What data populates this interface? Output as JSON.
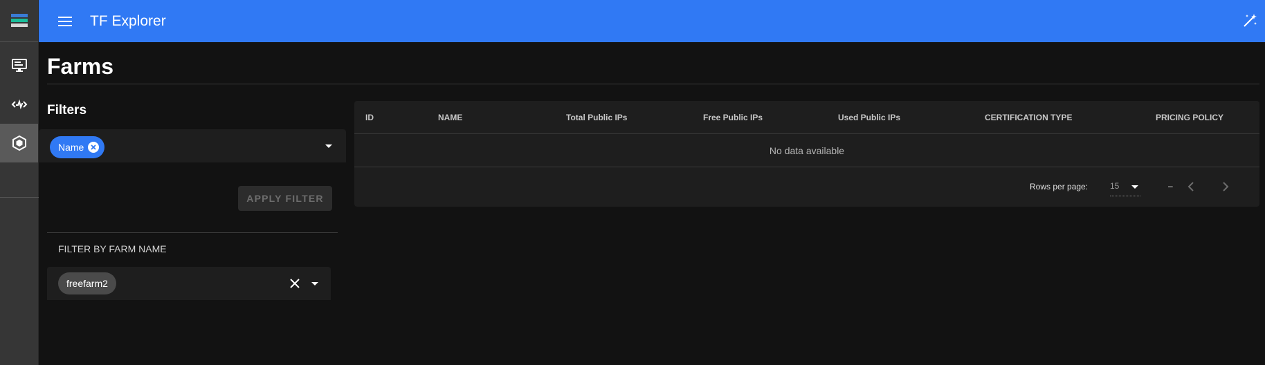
{
  "header": {
    "app_title": "TF Explorer",
    "accent_color": "#3079f4"
  },
  "rail": {
    "items": [
      {
        "icon": "logo-stack-icon"
      },
      {
        "icon": "monitor-icon"
      },
      {
        "icon": "code-pulse-icon"
      },
      {
        "icon": "cube-icon",
        "active": true
      }
    ]
  },
  "page": {
    "title": "Farms"
  },
  "filters": {
    "title": "Filters",
    "selected_chip": "Name",
    "apply_label": "APPLY FILTER",
    "farm_name_label": "FILTER BY FARM NAME",
    "farm_name_chip": "freefarm2"
  },
  "table": {
    "headers": [
      "ID",
      "NAME",
      "Total Public IPs",
      "Free Public IPs",
      "Used Public IPs",
      "CERTIFICATION TYPE",
      "PRICING POLICY"
    ],
    "empty_text": "No data available",
    "rows_per_page_label": "Rows per page:",
    "rows_per_page_value": "15",
    "range_text": "–"
  }
}
